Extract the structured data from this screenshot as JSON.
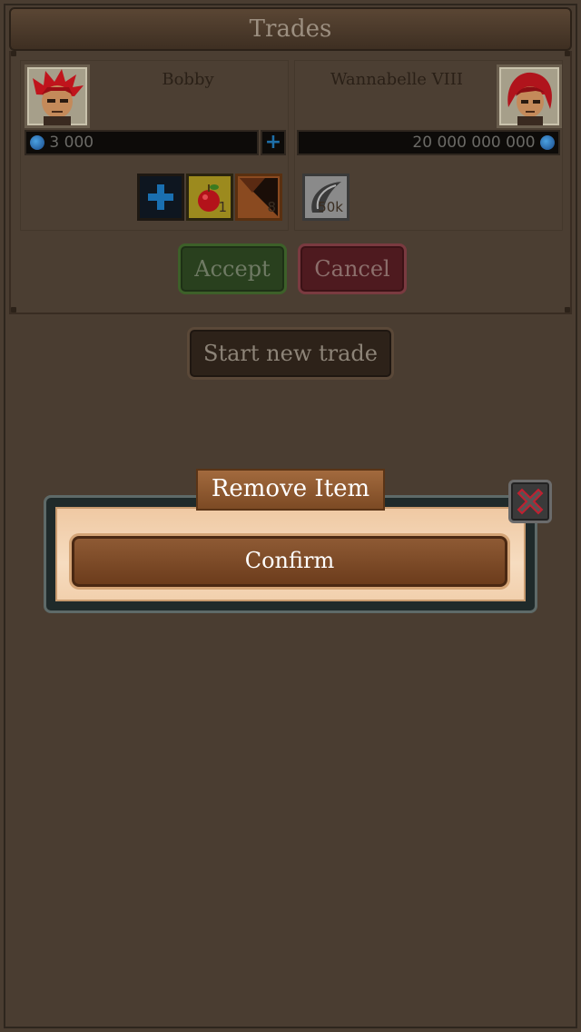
{
  "header": {
    "title": "Trades"
  },
  "trade": {
    "left_player": {
      "name": "Bobby",
      "gold": "3 000",
      "avatar_icon": "red-haired-hero-avatar",
      "items": [
        {
          "icon": "plus-icon",
          "qty": ""
        },
        {
          "icon": "apple-icon",
          "qty": "1"
        },
        {
          "icon": "leather-hide-icon",
          "qty": "8"
        }
      ]
    },
    "right_player": {
      "name": "Wannabelle VIII",
      "gold": "20 000 000 000",
      "avatar_icon": "red-haired-heroine-avatar",
      "items": [
        {
          "icon": "claw-icon",
          "qty": "50k"
        }
      ]
    },
    "accept_label": "Accept",
    "cancel_label": "Cancel"
  },
  "start_new_trade_label": "Start new trade",
  "modal": {
    "title": "Remove Item",
    "confirm_label": "Confirm",
    "close_icon": "close-x-icon"
  },
  "colors": {
    "background": "#4a3d31",
    "accept": "#29401e",
    "cancel": "#4e1a1f",
    "modal_panel": "#f6dcc0",
    "confirm_button": "#7c4a24"
  }
}
